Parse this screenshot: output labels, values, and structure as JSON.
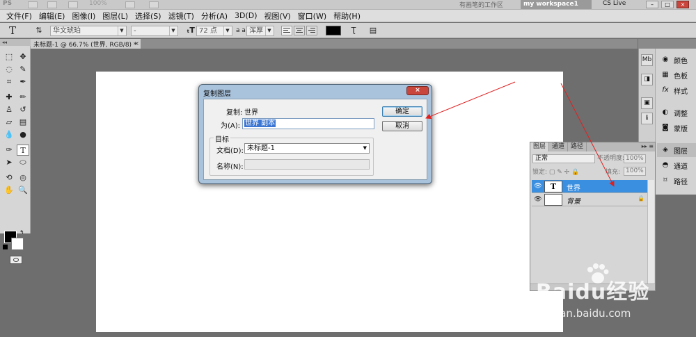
{
  "app": {
    "logo": "PS",
    "zoom": "100%",
    "workspace_label": "有画笔的工作区",
    "workspace_button": "my workspace1",
    "cs_live": "CS Live",
    "win_minimize": "–",
    "win_restore": "□",
    "win_close": "×"
  },
  "menu": [
    "文件(F)",
    "编辑(E)",
    "图像(I)",
    "图层(L)",
    "选择(S)",
    "滤镜(T)",
    "分析(A)",
    "3D(D)",
    "视图(V)",
    "窗口(W)",
    "帮助(H)"
  ],
  "options": {
    "tool_glyph": "T",
    "font_family": "华文琥珀",
    "font_style": "-",
    "font_size": "72 点",
    "aa_label": "a a",
    "antialias": "浑厚"
  },
  "document_tab": {
    "title": "未标题-1 @ 66.7% (世界, RGB/8) *",
    "close": "×"
  },
  "tools": [
    {
      "name": "marquee-tool",
      "glyph": "⬚"
    },
    {
      "name": "move-tool",
      "glyph": "✥"
    },
    {
      "name": "lasso-tool",
      "glyph": "◌"
    },
    {
      "name": "quick-select-tool",
      "glyph": "✎"
    },
    {
      "name": "crop-tool",
      "glyph": "⌗"
    },
    {
      "name": "eyedropper-tool",
      "glyph": "✒"
    },
    {
      "name": "healing-tool",
      "glyph": "✚"
    },
    {
      "name": "brush-tool",
      "glyph": "✏"
    },
    {
      "name": "stamp-tool",
      "glyph": "♙"
    },
    {
      "name": "history-brush-tool",
      "glyph": "↺"
    },
    {
      "name": "eraser-tool",
      "glyph": "▱"
    },
    {
      "name": "gradient-tool",
      "glyph": "▤"
    },
    {
      "name": "blur-tool",
      "glyph": "💧"
    },
    {
      "name": "dodge-tool",
      "glyph": "●"
    },
    {
      "name": "pen-tool",
      "glyph": "✑"
    },
    {
      "name": "type-tool",
      "glyph": "T"
    },
    {
      "name": "path-select-tool",
      "glyph": "➤"
    },
    {
      "name": "shape-tool",
      "glyph": "⬭"
    },
    {
      "name": "3d-rotate-tool",
      "glyph": "⟲"
    },
    {
      "name": "3d-orbit-tool",
      "glyph": "◎"
    },
    {
      "name": "hand-tool",
      "glyph": "✋"
    },
    {
      "name": "zoom-tool",
      "glyph": "🔍"
    }
  ],
  "dock": {
    "mini_icons": [
      "Mb",
      "◨",
      "▣",
      "ℹ"
    ],
    "panels": [
      {
        "icon": "◉",
        "label": "颜色"
      },
      {
        "icon": "▦",
        "label": "色板"
      },
      {
        "icon": "fx",
        "label": "样式"
      },
      {
        "icon": "◐",
        "label": "调整"
      },
      {
        "icon": "◙",
        "label": "蒙版"
      },
      {
        "icon": "◈",
        "label": "图层"
      },
      {
        "icon": "◓",
        "label": "通道"
      },
      {
        "icon": "⌑",
        "label": "路径"
      }
    ]
  },
  "layers_panel": {
    "tabs": [
      "图层",
      "通道",
      "路径"
    ],
    "menu_arrow": "▸▸ ≡",
    "blend_mode": "正常",
    "opacity_label": "不透明度:",
    "opacity": "100%",
    "lock_label": "锁定: ▢ ✎ ✢ 🔒",
    "fill_label": "填充:",
    "fill": "100%",
    "layers": [
      {
        "name": "世界",
        "thumb": "T",
        "selected": true,
        "locked": false
      },
      {
        "name": "背景",
        "thumb": "",
        "selected": false,
        "locked": true
      }
    ],
    "eye": "👁",
    "lock_icon": "🔒"
  },
  "dialog": {
    "title": "复制图层",
    "close": "×",
    "duplicate_label": "复制:",
    "duplicate_value": "世界",
    "as_label": "为(A):",
    "as_value": "世界 副本",
    "ok": "确定",
    "cancel": "取消",
    "target_label": "目标",
    "document_label": "文档(D):",
    "document_value": "未标题-1",
    "name_label": "名称(N):",
    "name_value": ""
  },
  "watermark": {
    "logo": "Baidu经验",
    "url": "jingyan.baidu.com"
  },
  "colors": {
    "selection": "#3b8fe0",
    "dialog_frame": "#a9c3dd",
    "annotation": "#e02020"
  }
}
